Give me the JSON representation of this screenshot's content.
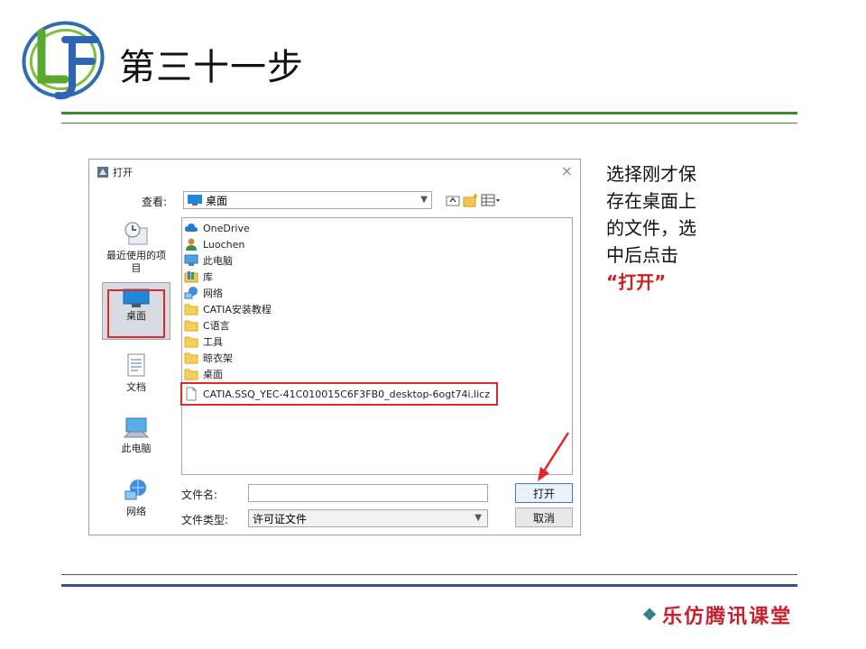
{
  "slide": {
    "title": "第三十一步",
    "brand": "乐仿腾讯课堂",
    "note_lines": [
      "选择刚才保",
      "存在桌面上",
      "的文件，选",
      "中后点击"
    ],
    "note_highlight": "“打开”"
  },
  "dialog": {
    "title": "打开",
    "look_in_label": "查看:",
    "look_in_value": "桌面",
    "places": [
      {
        "label": "最近使用的项目",
        "icon": "recent-icon"
      },
      {
        "label": "桌面",
        "icon": "desktop-icon",
        "selected": true
      },
      {
        "label": "文档",
        "icon": "documents-icon"
      },
      {
        "label": "此电脑",
        "icon": "computer-icon"
      },
      {
        "label": "网络",
        "icon": "network-icon"
      }
    ],
    "files": [
      {
        "name": "OneDrive",
        "icon": "cloud-icon"
      },
      {
        "name": "Luochen",
        "icon": "user-icon"
      },
      {
        "name": "此电脑",
        "icon": "computer-icon"
      },
      {
        "name": "库",
        "icon": "library-icon"
      },
      {
        "name": "网络",
        "icon": "network-icon"
      },
      {
        "name": "CATIA安装教程",
        "icon": "folder-icon"
      },
      {
        "name": "C语言",
        "icon": "folder-icon"
      },
      {
        "name": "工具",
        "icon": "folder-icon"
      },
      {
        "name": "晾衣架",
        "icon": "folder-icon"
      },
      {
        "name": "桌面",
        "icon": "folder-icon"
      },
      {
        "name": "CATIA.SSQ_YEC-41C010015C6F3FB0_desktop-6ogt74i.licz",
        "icon": "file-icon",
        "highlighted": true
      }
    ],
    "file_name_label": "文件名:",
    "file_name_value": "",
    "file_type_label": "文件类型:",
    "file_type_value": "许可证文件",
    "open_button": "打开",
    "cancel_button": "取消"
  },
  "colors": {
    "highlight_red": "#e0282a",
    "green_rule": "#3c8a2e",
    "blue_rule": "#34558a",
    "brand_red": "#c8202e"
  }
}
